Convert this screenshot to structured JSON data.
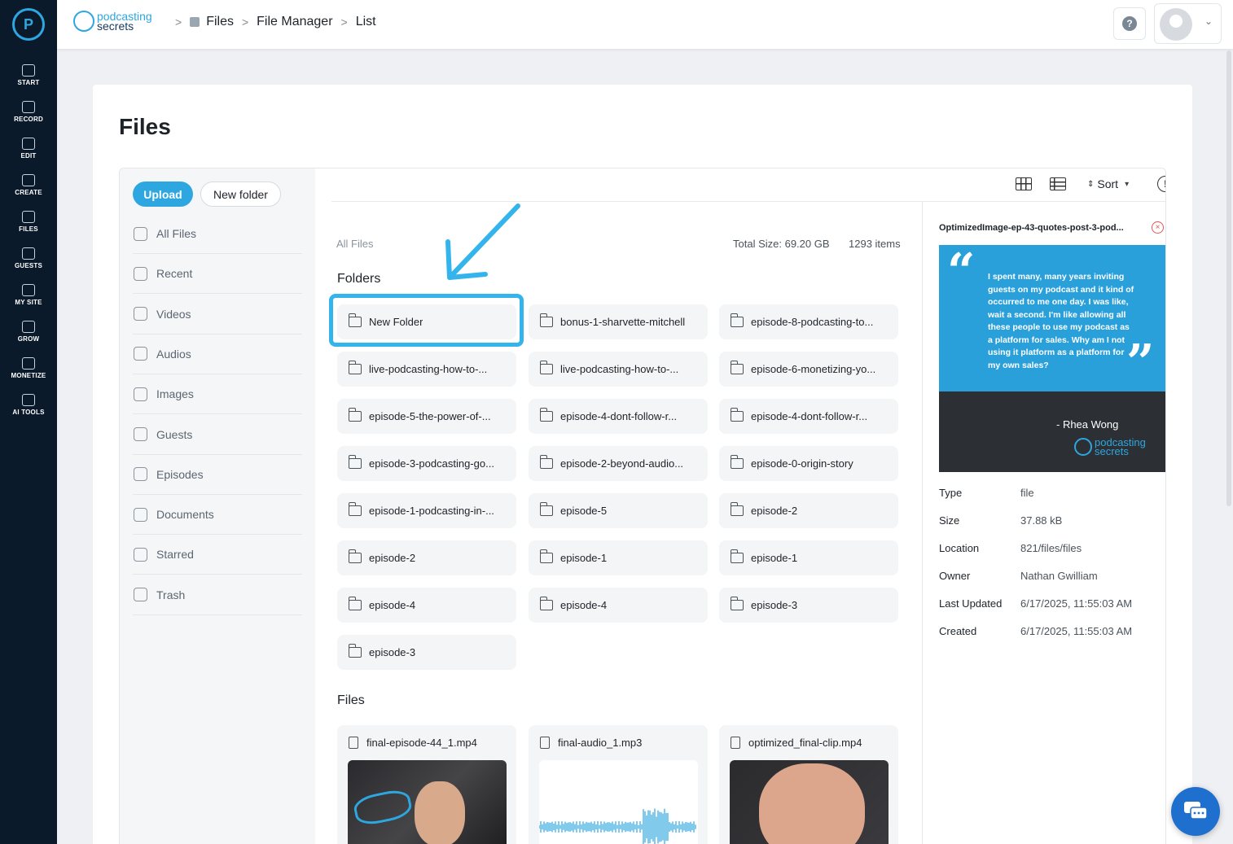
{
  "rail": {
    "items": [
      {
        "label": "START",
        "icon": "start-icon"
      },
      {
        "label": "RECORD",
        "icon": "microphone-icon"
      },
      {
        "label": "EDIT",
        "icon": "edit-icon"
      },
      {
        "label": "CREATE",
        "icon": "create-icon"
      },
      {
        "label": "FILES",
        "icon": "files-icon"
      },
      {
        "label": "GUESTS",
        "icon": "guests-icon"
      },
      {
        "label": "MY SITE",
        "icon": "site-icon"
      },
      {
        "label": "GROW",
        "icon": "grow-icon"
      },
      {
        "label": "MONETIZE",
        "icon": "monetize-icon"
      },
      {
        "label": "AI TOOLS",
        "icon": "ai-tools-icon"
      }
    ]
  },
  "topbar": {
    "brand_line1": "podcasting",
    "brand_line2": "secrets",
    "breadcrumb": [
      "Files",
      "File Manager",
      "List"
    ],
    "help_glyph": "?",
    "user_chevron": "⌄"
  },
  "page": {
    "title": "Files"
  },
  "sidebar": {
    "upload_label": "Upload",
    "new_folder_label": "New folder",
    "items": [
      {
        "label": "All Files",
        "icon": "all-files-icon"
      },
      {
        "label": "Recent",
        "icon": "clock-icon"
      },
      {
        "label": "Videos",
        "icon": "video-icon"
      },
      {
        "label": "Audios",
        "icon": "music-icon"
      },
      {
        "label": "Images",
        "icon": "image-icon"
      },
      {
        "label": "Guests",
        "icon": "guests-icon"
      },
      {
        "label": "Episodes",
        "icon": "episodes-icon"
      },
      {
        "label": "Documents",
        "icon": "document-icon"
      },
      {
        "label": "Starred",
        "icon": "star-icon"
      },
      {
        "label": "Trash",
        "icon": "trash-icon"
      }
    ]
  },
  "toolbar": {
    "sort_label": "Sort",
    "info_glyph": "!"
  },
  "content": {
    "location": "All Files",
    "total_size": "Total Size: 69.20 GB",
    "items_count": "1293 items",
    "folders_title": "Folders",
    "files_title": "Files",
    "folders": [
      "New Folder",
      "bonus-1-sharvette-mitchell",
      "episode-8-podcasting-to...",
      "live-podcasting-how-to-...",
      "live-podcasting-how-to-...",
      "episode-6-monetizing-yo...",
      "episode-5-the-power-of-...",
      "episode-4-dont-follow-r...",
      "episode-4-dont-follow-r...",
      "episode-3-podcasting-go...",
      "episode-2-beyond-audio...",
      "episode-0-origin-story",
      "episode-1-podcasting-in-...",
      "episode-5",
      "episode-2",
      "episode-2",
      "episode-1",
      "episode-1",
      "episode-4",
      "episode-4",
      "episode-3",
      "episode-3"
    ],
    "files": [
      {
        "name": "final-episode-44_1.mp4",
        "icon": "video-file-icon"
      },
      {
        "name": "final-audio_1.mp3",
        "icon": "microphone-icon"
      },
      {
        "name": "optimized_final-clip.mp4",
        "icon": "video-file-icon"
      }
    ]
  },
  "detail": {
    "file_name": "OptimizedImage-ep-43-quotes-post-3-pod...",
    "close_glyph": "×",
    "preview": {
      "quote": "I spent many, many years inviting guests on my podcast and it kind of occurred to me one day. I was like, wait a second. I'm like allowing all these people to use my podcast as a platform for sales. Why am I not using it platform as a platform for my own sales?",
      "author": "- Rhea Wong",
      "brand_line1": "podcasting",
      "brand_line2": "secrets"
    },
    "meta": [
      {
        "key": "Type",
        "value": "file"
      },
      {
        "key": "Size",
        "value": "37.88 kB"
      },
      {
        "key": "Location",
        "value": "821/files/files"
      },
      {
        "key": "Owner",
        "value": "Nathan Gwilliam"
      },
      {
        "key": "Last Updated",
        "value": "6/17/2025, 11:55:03 AM"
      },
      {
        "key": "Created",
        "value": "6/17/2025, 11:55:03 AM"
      }
    ]
  },
  "colors": {
    "accent": "#2ea7e0",
    "rail_bg": "#0b1a2b",
    "highlight": "#33b4ec"
  }
}
